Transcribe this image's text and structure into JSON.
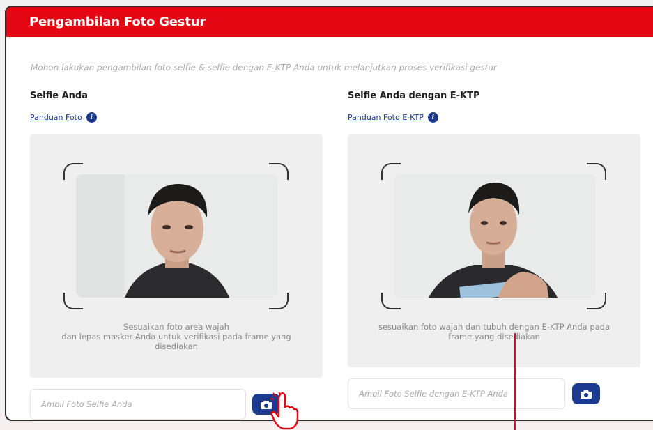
{
  "header": {
    "title": "Pengambilan Foto Gestur"
  },
  "instruction": "Mohon lakukan pengambilan foto selfie & selfie dengan E-KTP Anda untuk melanjutkan proses verifikasi gestur",
  "left": {
    "title": "Selfie Anda",
    "guide_link": "Panduan Foto",
    "hint_line1": "Sesuaikan foto area wajah",
    "hint_line2": "dan lepas masker Anda untuk verifikasi pada frame yang",
    "hint_line3": "disediakan",
    "input_placeholder": "Ambil Foto Selfie Anda"
  },
  "right": {
    "title": "Selfie Anda dengan E-KTP",
    "guide_link": "Panduan Foto E-KTP",
    "hint_line1": "sesuaikan foto wajah dan tubuh dengan E-KTP Anda pada",
    "hint_line2": "frame yang disediakan",
    "input_placeholder": "Ambil Foto Selfie dengan E-KTP Anda"
  },
  "icons": {
    "info": "info-icon",
    "camera": "camera-icon",
    "pointer": "hand-pointer-icon"
  },
  "colors": {
    "brand_red": "#e30613",
    "brand_blue": "#1b3a8f"
  }
}
